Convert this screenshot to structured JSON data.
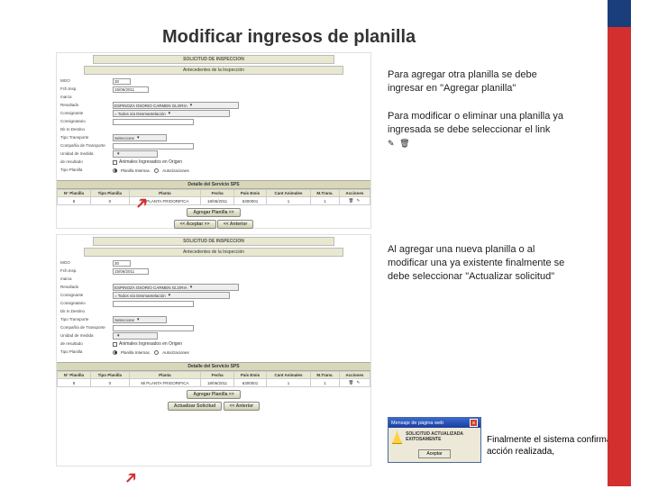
{
  "title": "Modificar ingresos de planilla",
  "notes": {
    "n1": "Para agregar otra planilla se debe ingresar en \"Agregar planilla\"",
    "n2": "Para modificar o eliminar una planilla ya ingresada se debe seleccionar el link",
    "n3": "Al agregar una nueva planilla o al modificar una ya existente finalmente se debe seleccionar \"Actualizar solicitud\"",
    "n4": "Finalmente el sistema confirma la acción realizada,"
  },
  "panel": {
    "header": "SOLICITUD DE INSPECCION",
    "section": "Antecedentes de la Inspección",
    "detail_band": "Detalle del Servicio SPS",
    "labels": {
      "l0": "MGO",
      "l1": "Fch.Insp.",
      "l2": "marca",
      "l3": "Resultado",
      "l4": "Consignante",
      "l5": "Consignatario",
      "l6": "Dir.m.Destino",
      "l7": "Tipo Transporte",
      "l8": "Compañía de Transporte",
      "l9": "Unidad de medida",
      "l10": "de resultado",
      "l11": "Tipo Planilla"
    },
    "values": {
      "mgo": "30",
      "fecha": "15/06/2011",
      "result_sel": "ESPINOZA OSORIO CARMEN GLORIA",
      "transport_sel": "= Todos vía Desmantelación",
      "company": "Seleccione",
      "origen_label": "Animales Ingresados en Origen",
      "radio_a": "Planilla Internac.",
      "radio_b": "Autorizaciones"
    },
    "table": {
      "headers": [
        "N° Planilla",
        "Tipo Planilla",
        "Planta",
        "Fecha",
        "País Emis",
        "Cant Animales",
        "M.Trans.",
        "Acciones"
      ],
      "rows": [
        {
          "np": "8",
          "tipo": "0",
          "planta": "Mi PLANTA FRIGORIFICA",
          "fecha": "18/06/2011",
          "pais": "6300001",
          "cant": "1",
          "mt": "1",
          "acc": "edit"
        }
      ]
    },
    "buttons": {
      "agregar": "Agregar Planilla >>",
      "actualizar": "Actualizar Solicitud",
      "ok": "<< Aceptar >>",
      "anterior": "<< Anterior"
    }
  },
  "dialog": {
    "title": "Mensaje de página web",
    "text": "SOLICITUD ACTUALIZADA EXITOSAMENTE",
    "btn": "Aceptar"
  }
}
